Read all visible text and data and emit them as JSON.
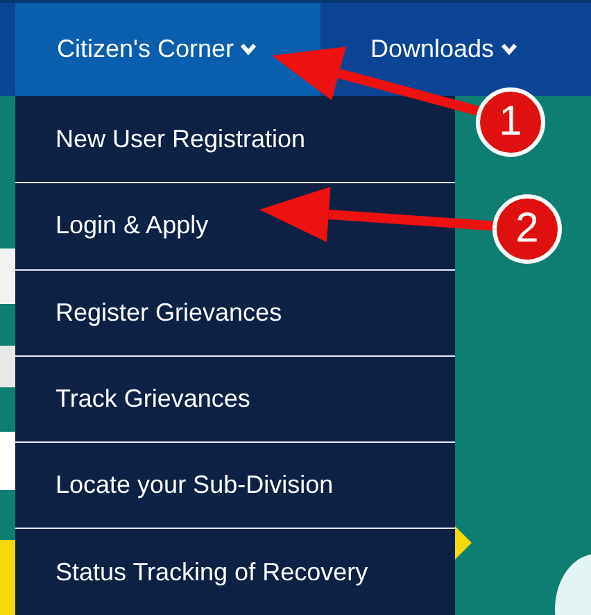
{
  "nav": {
    "items": [
      {
        "label": "Citizen's Corner",
        "selected": true
      },
      {
        "label": "Downloads",
        "selected": false
      }
    ]
  },
  "dropdown": {
    "items": [
      {
        "label": "New User Registration"
      },
      {
        "label": "Login & Apply"
      },
      {
        "label": "Register Grievances"
      },
      {
        "label": "Track Grievances"
      },
      {
        "label": "Locate your Sub-Division"
      },
      {
        "label": "Status Tracking of Recovery"
      }
    ]
  },
  "annotations": [
    {
      "label": "1"
    },
    {
      "label": "2"
    }
  ]
}
